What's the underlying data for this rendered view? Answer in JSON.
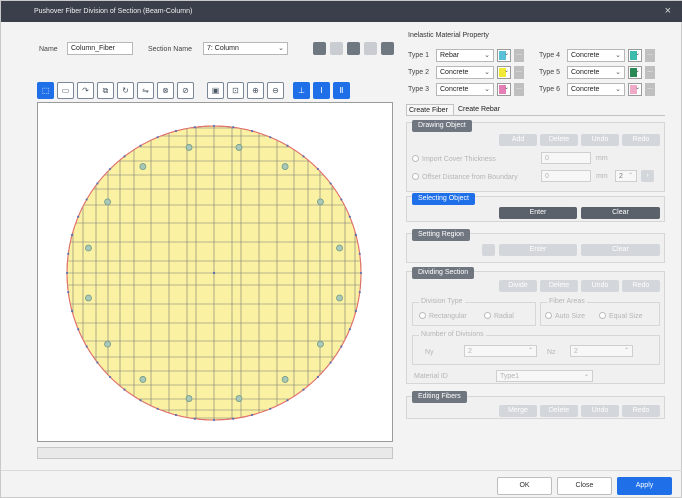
{
  "window": {
    "title": "Pushover Fiber Division of Section (Beam-Column)",
    "close_glyph": "×"
  },
  "header": {
    "name_label": "Name",
    "name_value": "Column_Fiber",
    "section_label": "Section Name",
    "section_value": "7: Column"
  },
  "toolbar": {
    "icons": [
      "select-icon",
      "polygon-icon",
      "move-icon",
      "copy-icon",
      "rotate-icon",
      "mirror-icon",
      "delete-icon",
      "erase-icon",
      "fit-icon",
      "zoom-window-icon",
      "zoom-in-icon",
      "zoom-out-icon",
      "section-icon",
      "i-section-icon",
      "channel-icon"
    ],
    "glyphs": [
      "⬚",
      "▭",
      "↷",
      "⧉",
      "↻",
      "⇋",
      "⊗",
      "⊘",
      "▣",
      "⊡",
      "⊕",
      "⊖",
      "⊥",
      "Ⅰ",
      "Ⅱ"
    ]
  },
  "material": {
    "heading": "Inelastic Material Property",
    "types": [
      {
        "label": "Type 1",
        "value": "Rebar",
        "color": "#5bbfd8"
      },
      {
        "label": "Type 2",
        "value": "Concrete",
        "color": "#f2e836"
      },
      {
        "label": "Type 3",
        "value": "Concrete",
        "color": "#e47fb6"
      },
      {
        "label": "Type 4",
        "value": "Concrete",
        "color": "#3dbcae"
      },
      {
        "label": "Type 5",
        "value": "Concrete",
        "color": "#2a8a57"
      },
      {
        "label": "Type 6",
        "value": "Concrete",
        "color": "#f1a9c8"
      }
    ],
    "dots": "..."
  },
  "tabs": [
    "Create Fiber",
    "Create Rebar"
  ],
  "drawing": {
    "title": "Drawing Object",
    "buttons": [
      "Add",
      "Delete",
      "Undo",
      "Redo"
    ],
    "cover_label": "Import Cover Thickness",
    "cover_value": "0",
    "cover_unit": "mm",
    "offset_label": "Offset Distance from Boundary",
    "offset_value": "0",
    "offset_unit": "mm",
    "offset_count": "2"
  },
  "selecting": {
    "title": "Selecting Object",
    "enter": "Enter",
    "clear": "Clear"
  },
  "region": {
    "title": "Setting Region",
    "enter": "Enter",
    "clear": "Clear"
  },
  "dividing": {
    "title": "Dividing Section",
    "buttons": [
      "Divide",
      "Delete",
      "Undo",
      "Redo"
    ],
    "division_type": "Division Type",
    "rect": "Rectangular",
    "radial": "Radial",
    "fiber_areas": "Fiber Areas",
    "auto": "Auto Size",
    "equal": "Equal Size",
    "num_div": "Number of Divisions",
    "ny_label": "Ny",
    "ny_value": "2",
    "nz_label": "Nz",
    "nz_value": "2",
    "material_label": "Material ID",
    "material_value": "Type1"
  },
  "editing": {
    "title": "Editing Fibers",
    "buttons": [
      "Merge",
      "Delete",
      "Undo",
      "Redo"
    ]
  },
  "footer": {
    "ok": "OK",
    "close": "Close",
    "apply": "Apply"
  },
  "colors": {
    "fill": "#fbf1a3",
    "edge": "#e0706c",
    "rebar": "#aac8b8",
    "accent": "#1e6fe8"
  }
}
